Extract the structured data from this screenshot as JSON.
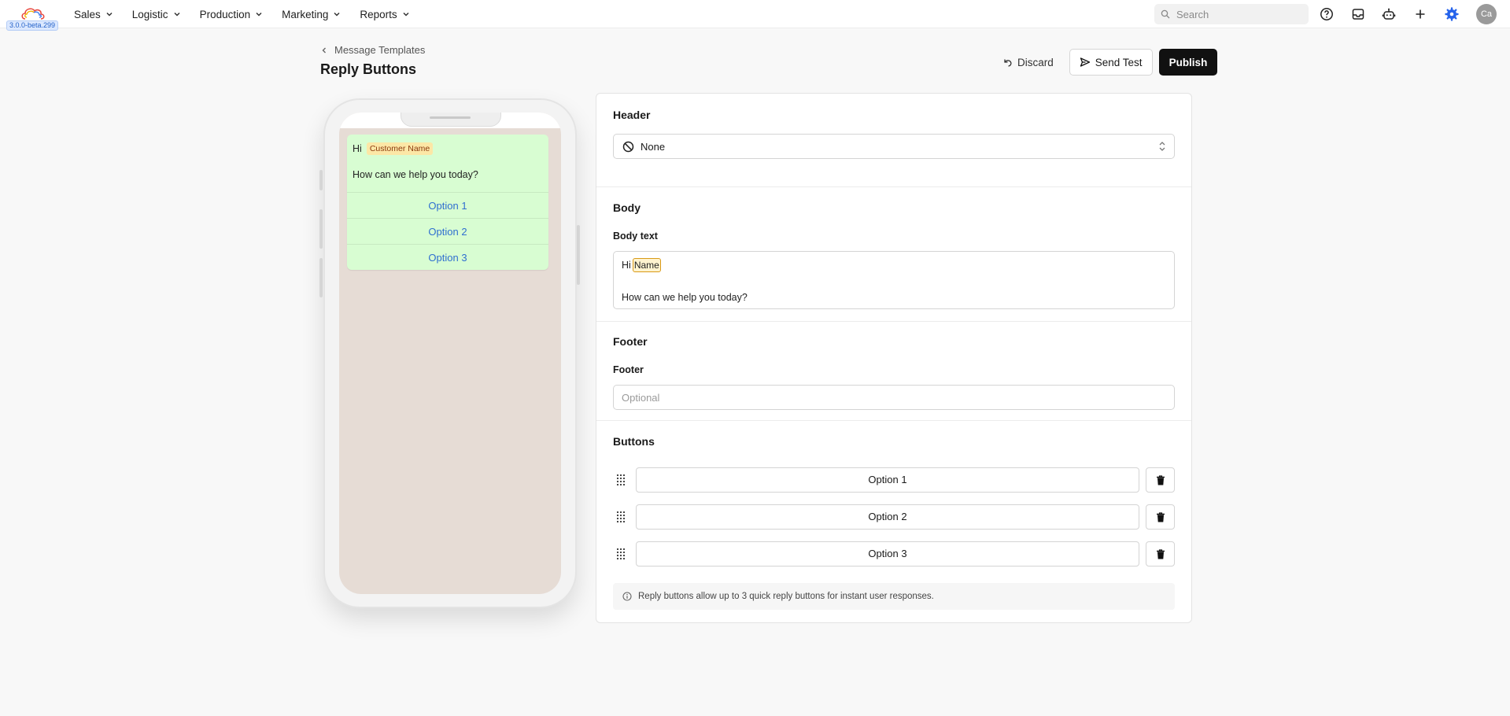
{
  "app": {
    "version": "3.0.0-beta.299",
    "nav": [
      {
        "label": "Sales"
      },
      {
        "label": "Logistic"
      },
      {
        "label": "Production"
      },
      {
        "label": "Marketing"
      },
      {
        "label": "Reports"
      }
    ],
    "search_placeholder": "Search",
    "user_initials": "Ca",
    "icons": [
      "help-circle-icon",
      "inbox-icon",
      "bot-icon",
      "plus-icon",
      "gear-icon"
    ],
    "accent_color": "#2563eb"
  },
  "page": {
    "breadcrumb": "Message Templates",
    "title": "Reply Buttons",
    "actions": {
      "discard": "Discard",
      "send_test": "Send Test",
      "publish": "Publish"
    }
  },
  "preview": {
    "greeting": "Hi",
    "variable_tag": "Customer Name",
    "body": "How can we help you today?",
    "options": [
      "Option 1",
      "Option 2",
      "Option 3"
    ]
  },
  "form": {
    "header": {
      "title": "Header",
      "selected": "None"
    },
    "body": {
      "title": "Body",
      "label": "Body text",
      "greeting": "Hi",
      "variable": "Name",
      "text": "How can we help you today?"
    },
    "footer": {
      "title": "Footer",
      "label": "Footer",
      "placeholder": "Optional",
      "value": ""
    },
    "buttons": {
      "title": "Buttons",
      "items": [
        "Option 1",
        "Option 2",
        "Option 3"
      ],
      "note": "Reply buttons allow up to 3 quick reply buttons for instant user responses."
    }
  }
}
